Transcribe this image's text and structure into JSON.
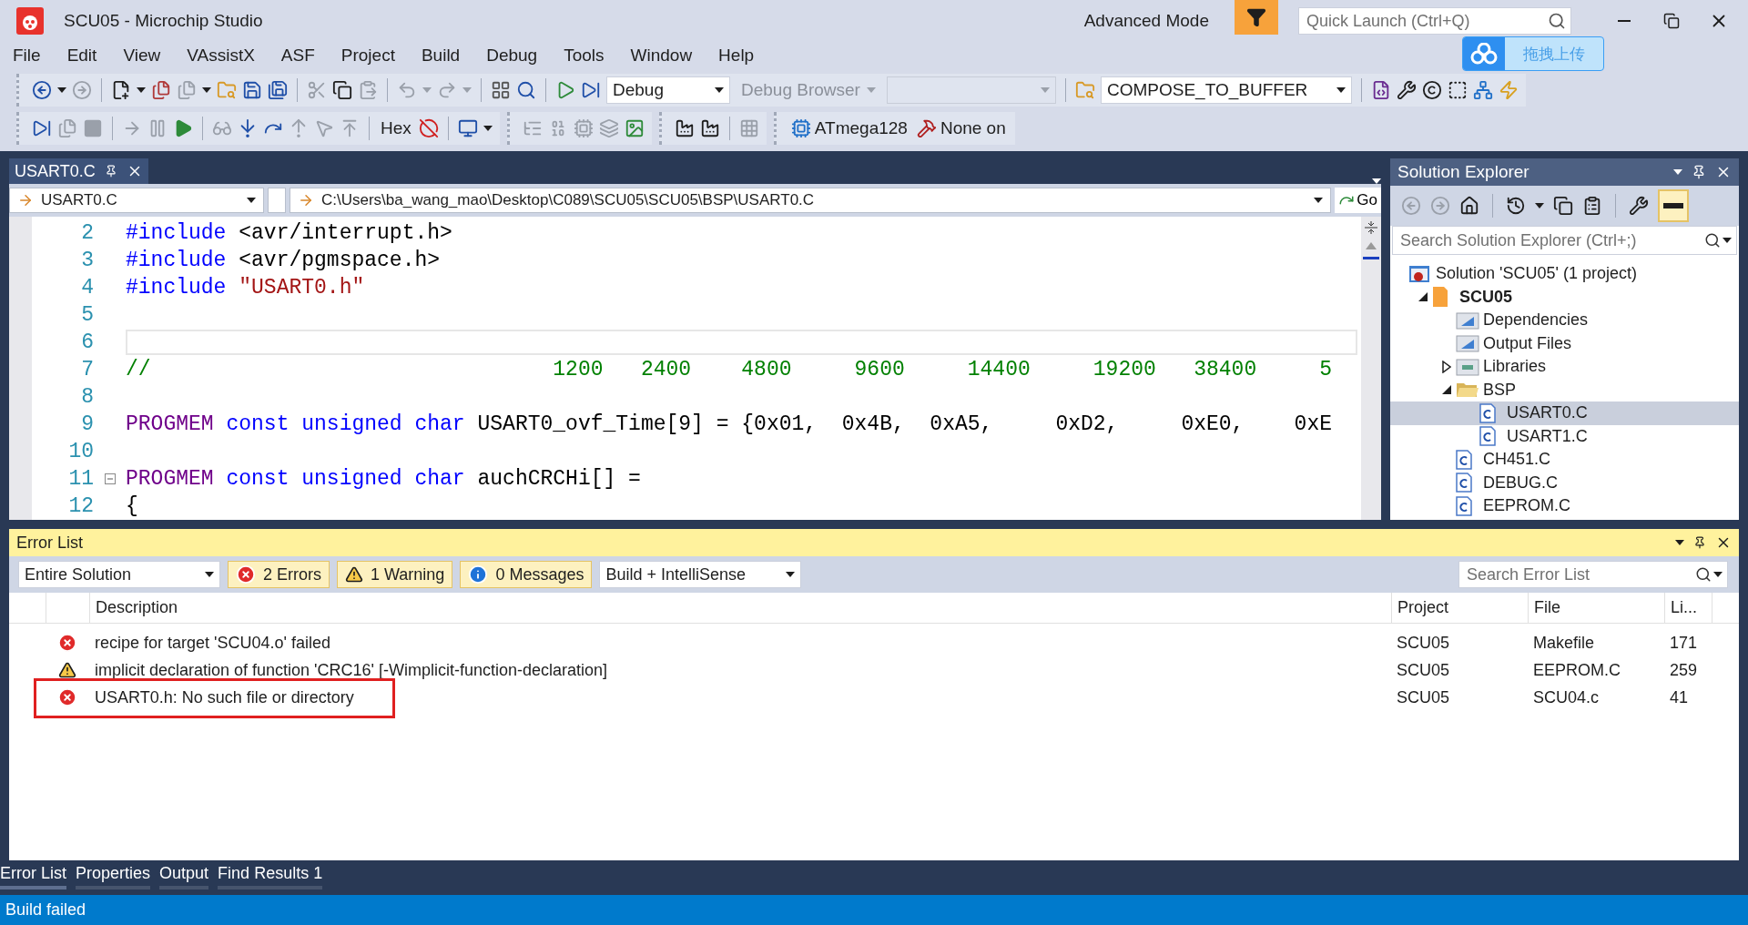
{
  "window": {
    "title": "SCU05 - Microchip Studio",
    "mode": "Advanced Mode",
    "quick_launch": {
      "placeholder": "Quick Launch (Ctrl+Q)"
    },
    "upload_button": "拖拽上传"
  },
  "menu": [
    "File",
    "Edit",
    "View",
    "VAssistX",
    "ASF",
    "Project",
    "Build",
    "Debug",
    "Tools",
    "Window",
    "Help"
  ],
  "toolbar": {
    "configuration": "Debug",
    "debug_browser": {
      "label": "Debug Browser",
      "disabled": true
    },
    "project_target": "COMPOSE_TO_BUFFER",
    "hex": "Hex",
    "device": "ATmega128",
    "tool": "None on"
  },
  "editor": {
    "tab": {
      "label": "USART0.C"
    },
    "nav": {
      "file": "USART0.C",
      "path": "C:\\Users\\ba_wang_mao\\Desktop\\C089\\SCU05\\SCU05\\BSP\\USART0.C",
      "go": "Go"
    },
    "lines": [
      {
        "number": "2",
        "segments": [
          {
            "kind": "keyword",
            "text": "#include"
          },
          {
            "kind": "plain",
            "text": " <avr/interrupt.h>"
          }
        ]
      },
      {
        "number": "3",
        "segments": [
          {
            "kind": "keyword",
            "text": "#include"
          },
          {
            "kind": "plain",
            "text": " <avr/pgmspace.h>"
          }
        ]
      },
      {
        "number": "4",
        "segments": [
          {
            "kind": "keyword",
            "text": "#include"
          },
          {
            "kind": "string",
            "text": " \"USART0.h\""
          }
        ]
      },
      {
        "number": "5",
        "current": false
      },
      {
        "number": "6",
        "current": true
      },
      {
        "number": "7",
        "segments": [
          {
            "kind": "comment",
            "text": "//                                1200   2400    4800     9600     14400     19200   38400     5"
          }
        ]
      },
      {
        "number": "8"
      },
      {
        "number": "9",
        "segments": [
          {
            "kind": "macro",
            "text": "PROGMEM"
          },
          {
            "kind": "keyword",
            "text": " const unsigned char"
          },
          {
            "kind": "plain",
            "text": " USART0_ovf_Time[9] = {0x01,  0x4B,  0xA5,     0xD2,     0xE0,    0xE"
          }
        ]
      },
      {
        "number": "10"
      },
      {
        "number": "11",
        "foldable": true,
        "segments": [
          {
            "kind": "macro",
            "text": "PROGMEM"
          },
          {
            "kind": "keyword",
            "text": " const unsigned char"
          },
          {
            "kind": "plain",
            "text": " auchCRCHi[] ="
          }
        ]
      },
      {
        "number": "12",
        "segments": [
          {
            "kind": "plain",
            "text": "{"
          }
        ]
      }
    ]
  },
  "solution_explorer": {
    "title": "Solution Explorer",
    "search": {
      "placeholder": "Search Solution Explorer (Ctrl+;)"
    },
    "tree": [
      {
        "label": "Solution 'SCU05' (1 project)",
        "kind": "solution",
        "selected": false,
        "children": [
          {
            "label": "SCU05",
            "kind": "project",
            "expanded": true,
            "selected": false,
            "children": [
              {
                "label": "Dependencies",
                "kind": "virtual",
                "selected": false
              },
              {
                "label": "Output Files",
                "kind": "virtual",
                "selected": false
              },
              {
                "label": "Libraries",
                "kind": "library",
                "expanded": false,
                "selected": false
              },
              {
                "label": "BSP",
                "kind": "folder",
                "expanded": true,
                "selected": false,
                "children": [
                  {
                    "label": "USART0.C",
                    "kind": "file",
                    "selected": true
                  },
                  {
                    "label": "USART1.C",
                    "kind": "file",
                    "selected": false
                  }
                ]
              },
              {
                "label": "CH451.C",
                "kind": "file",
                "selected": false
              },
              {
                "label": "DEBUG.C",
                "kind": "file",
                "selected": false
              },
              {
                "label": "EEPROM.C",
                "kind": "file",
                "selected": false
              }
            ]
          }
        ]
      }
    ]
  },
  "error_list": {
    "title": "Error List",
    "scope": "Entire Solution",
    "filters": [
      {
        "label": "2 Errors",
        "kind": "error",
        "on": true
      },
      {
        "label": "1 Warning",
        "kind": "warning",
        "on": true
      },
      {
        "label": "0 Messages",
        "kind": "message",
        "on": true
      }
    ],
    "source": "Build + IntelliSense",
    "search": {
      "placeholder": "Search Error List"
    },
    "columns": [
      "Description",
      "Project",
      "File",
      "Li..."
    ],
    "rows": [
      {
        "kind": "error",
        "description": "recipe for target 'SCU04.o' failed",
        "project": "SCU05",
        "file": "Makefile",
        "line": "171",
        "highlighted": false
      },
      {
        "kind": "warning",
        "description": "implicit declaration of function 'CRC16' [-Wimplicit-function-declaration]",
        "project": "SCU05",
        "file": "EEPROM.C",
        "line": "259",
        "highlighted": false
      },
      {
        "kind": "error",
        "description": "USART0.h: No such file or directory",
        "project": "SCU05",
        "file": "SCU04.c",
        "line": "41",
        "highlighted": true
      }
    ]
  },
  "bottom_tabs": [
    {
      "label": "Error List",
      "selected": true
    },
    {
      "label": "Properties",
      "selected": false
    },
    {
      "label": "Output",
      "selected": false
    },
    {
      "label": "Find Results 1",
      "selected": false
    }
  ],
  "status_bar": "Build failed"
}
